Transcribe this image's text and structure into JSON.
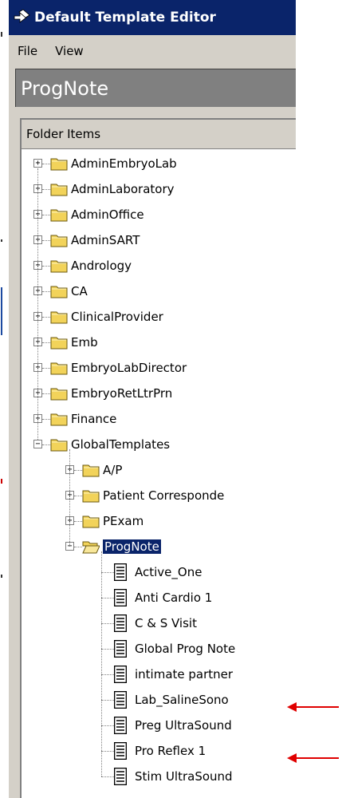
{
  "window": {
    "title": "Default Template Editor"
  },
  "menu": [
    "File",
    "View"
  ],
  "header": {
    "title": "ProgNote"
  },
  "folder_panel": {
    "header": "Folder Items"
  },
  "top_folders": [
    "AdminEmbryoLab",
    "AdminLaboratory",
    "AdminOffice",
    "AdminSART",
    "Andrology",
    "CA",
    "ClinicalProvider",
    "Emb",
    "EmbryoLabDirector",
    "EmbryoRetLtrPrn",
    "Finance",
    "GlobalTemplates"
  ],
  "global_children": [
    "A/P",
    "Patient Corresponde",
    "PExam",
    "ProgNote"
  ],
  "prognote_items": [
    "Active_One",
    "Anti Cardio 1",
    "C & S Visit",
    "Global Prog Note",
    "intimate partner",
    "Lab_SalineSono",
    "Preg UltraSound",
    "Pro Reflex 1",
    "Stim UltraSound"
  ],
  "colors": {
    "titlebar": "#0a246a",
    "selection": "#0a246a",
    "arrow": "#e00000",
    "folder": "#f2d35a"
  },
  "icons": {
    "folder": "folder-icon",
    "open_folder": "open-folder-icon",
    "document": "document-icon",
    "arrow": "red-arrow-icon"
  }
}
